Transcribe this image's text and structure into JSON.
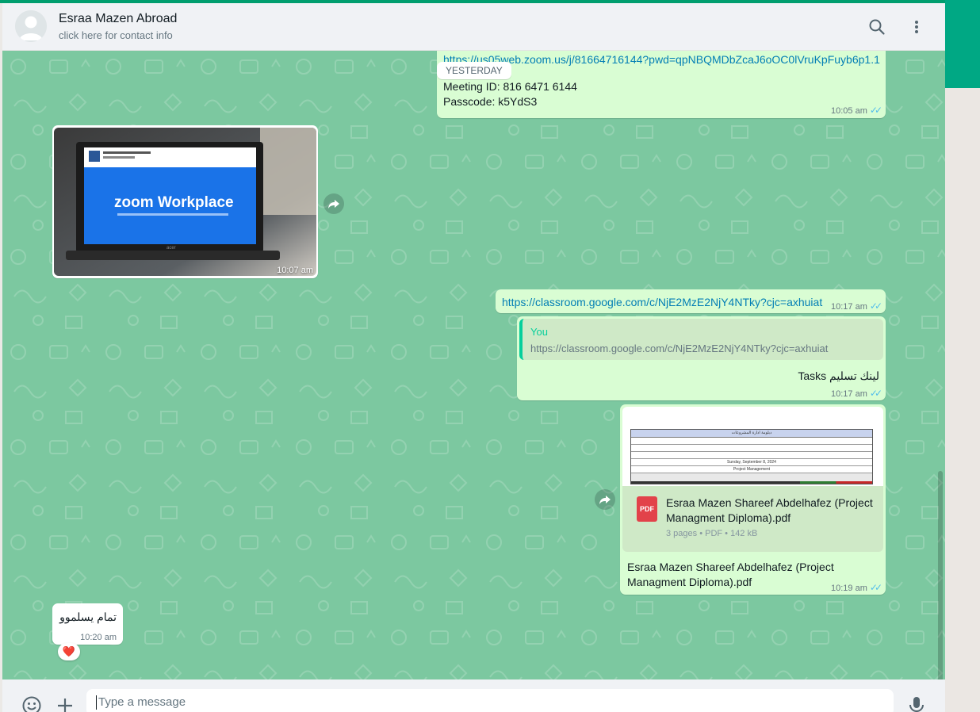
{
  "colors": {
    "accent": "#00a884",
    "chat_bg": "#7cc8a0",
    "outgoing": "#d9fdd3",
    "incoming": "#ffffff",
    "link": "#027eb5",
    "tick": "#53bdeb"
  },
  "header": {
    "name": "Esraa Mazen Abroad",
    "subtitle": "click here for contact info",
    "icons": [
      "search-icon",
      "menu-icon"
    ]
  },
  "date_chip": "YESTERDAY",
  "messages": {
    "zoom": {
      "link": "https://us05web.zoom.us/j/81664716144?pwd=qpNBQMDbZcaJ6oOC0lVruKpFuyb6p1.1",
      "meeting_id": "Meeting ID: 816 6471 6144",
      "passcode": "Passcode: k5YdS3",
      "time": "10:05 am"
    },
    "image": {
      "screen_text": "zoom Workplace",
      "brand": "acer",
      "time": "10:07 am"
    },
    "classroom_link": {
      "link": "https://classroom.google.com/c/NjE2MzE2NjY4NTky?cjc=axhuiat",
      "time": "10:17 am"
    },
    "reply": {
      "quoted_author": "You",
      "quoted_text": "https://classroom.google.com/c/NjE2MzE2NjY4NTky?cjc=axhuiat",
      "text": "لينك تسليم Tasks",
      "time": "10:17 am"
    },
    "document": {
      "preview_title": "دبلومة ادارة المشروعات",
      "preview_subtitle": "Project Management",
      "preview_date": "Sunday, September 8, 2024",
      "file_name": "Esraa Mazen Shareef Abdelhafez (Project Managment Diploma).pdf",
      "meta": "3 pages • PDF • 142 kB",
      "pdf_label": "PDF",
      "caption": "Esraa Mazen Shareef Abdelhafez (Project Managment Diploma).pdf",
      "time": "10:19 am"
    },
    "thanks": {
      "text": "تمام يسلموو",
      "time": "10:20 am",
      "reaction": "❤️"
    }
  },
  "footer": {
    "placeholder": "Type a message",
    "icons": [
      "emoji-icon",
      "plus-icon",
      "microphone-icon"
    ]
  }
}
